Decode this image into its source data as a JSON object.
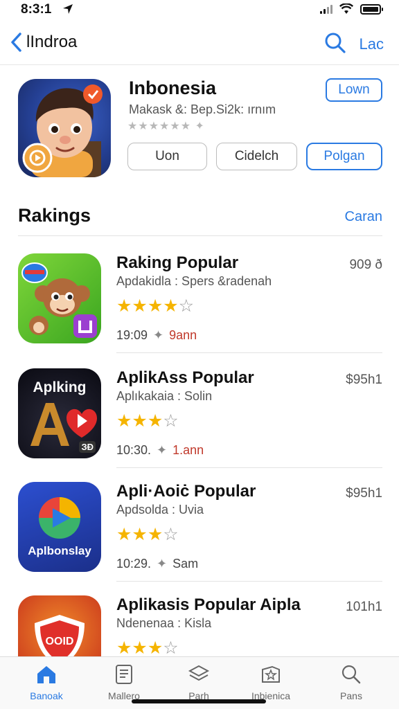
{
  "status_bar": {
    "time": "8:3:1",
    "icons": [
      "location-arrow-icon",
      "signal-icon",
      "wifi-icon",
      "battery-icon"
    ]
  },
  "nav": {
    "back_label": "lIndroa",
    "right_label": "Lac"
  },
  "header_app": {
    "title": "Inbonesia",
    "subtitle": "Makask &: Bep.Si2k: ırnım",
    "rating_text": "★★★★★★ ✦",
    "get_label": "Lown",
    "pills": [
      "Uon",
      "Cidelch",
      "Polgan"
    ]
  },
  "section": {
    "title": "Rakings",
    "link": "Caran"
  },
  "items": [
    {
      "title": "Raking Popular",
      "subtitle": "Apdakidla : Spers &radenah",
      "stars": 4,
      "time": "19:09",
      "meta": "9ann",
      "size": "909 ð"
    },
    {
      "title": "AplikAss Popular",
      "subtitle": "Aplıkakaia : Solin",
      "stars": 3,
      "time": "10:30.",
      "meta": "1.ann",
      "size": "$95h1",
      "icon_text": "Aplking",
      "icon_badge": "ЗƉ"
    },
    {
      "title": "Apli·Aoiċ Popular",
      "subtitle": "Apdsolda : Uvia",
      "stars": 3,
      "time": "10:29.",
      "meta": "Sam",
      "size": "$95h1",
      "icon_text": "Aplbonslay"
    },
    {
      "title": "Aplikasis Popular Aipla",
      "subtitle": "Ndenenaa : Kisla",
      "stars": 3,
      "time": "",
      "meta": "",
      "size": "101h1",
      "icon_text": "OOID"
    }
  ],
  "tabs": [
    {
      "label": "Banoak",
      "icon": "home-icon",
      "active": true
    },
    {
      "label": "Mallero",
      "icon": "document-icon",
      "active": false
    },
    {
      "label": "Parh",
      "icon": "stack-icon",
      "active": false
    },
    {
      "label": "Inbienica",
      "icon": "star-card-icon",
      "active": false
    },
    {
      "label": "Pans",
      "icon": "search-icon",
      "active": false
    }
  ],
  "colors": {
    "accent": "#2a7ae2",
    "star": "#f5b400",
    "highlight": "#c0392b"
  }
}
